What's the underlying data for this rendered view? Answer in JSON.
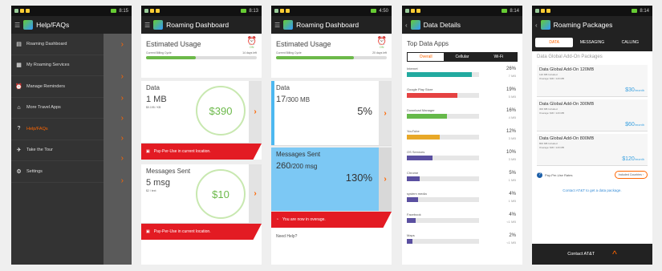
{
  "status": {
    "time1": "8:15",
    "time2": "8:13",
    "time3": "4:50",
    "time4": "8:14",
    "time5": "8:14"
  },
  "phone1": {
    "title": "Help/FAQs",
    "menu": [
      {
        "label": "Roaming Dashboard",
        "icon": "dashboard-icon"
      },
      {
        "label": "My Roaming Services",
        "icon": "services-icon"
      },
      {
        "label": "Manage Reminders",
        "icon": "reminder-icon"
      },
      {
        "label": "More Travel Apps",
        "icon": "travel-apps-icon"
      },
      {
        "label": "Help/FAQs",
        "icon": "help-icon"
      },
      {
        "label": "Take the Tour",
        "icon": "plane-icon"
      },
      {
        "label": "Settings",
        "icon": "gear-icon"
      }
    ]
  },
  "phone2": {
    "title": "Roaming Dashboard",
    "usage_title": "Estimated Usage",
    "cycle_label": "Current Billing Cycle",
    "days_left": "14 days left",
    "on": "ON",
    "cycle_progress": 0.45,
    "data_label": "Data",
    "data_value": "1 MB",
    "data_rate": "$0.195 / KB",
    "data_price": "$390",
    "alert1": "Pay-Per-Use in current location.",
    "msg_label": "Messages Sent",
    "msg_value": "5 msg",
    "msg_rate": "$2 / text",
    "msg_price": "$10",
    "alert2": "Pay-Per-Use in current location."
  },
  "phone3": {
    "title": "Roaming Dashboard",
    "usage_title": "Estimated Usage",
    "cycle_label": "Current Billing Cycle",
    "days_left": "20 days left",
    "on": "ON",
    "cycle_progress": 0.7,
    "data_label": "Data",
    "data_value": "17",
    "data_total": "/300 MB",
    "data_pct": "5%",
    "data_fill": 0.05,
    "msg_label": "Messages Sent",
    "msg_value": "260",
    "msg_total": "/200 msg",
    "msg_pct": "130%",
    "msg_fill": 1.0,
    "alert": "You are now in overage.",
    "help": "Need Help?"
  },
  "phone4": {
    "title": "Data Details",
    "heading": "Top Data Apps",
    "tabs": [
      "Overall",
      "Cellular",
      "Wi-Fi"
    ],
    "apps": [
      {
        "name": "Internet",
        "pct": "26%",
        "size": "7 MB",
        "fill": 0.9,
        "color": "#22aaa0"
      },
      {
        "name": "Google Play Store",
        "pct": "19%",
        "size": "5 MB",
        "fill": 0.7,
        "color": "#e54242"
      },
      {
        "name": "Download Manager",
        "pct": "16%",
        "size": "4 MB",
        "fill": 0.55,
        "color": "#66b94a"
      },
      {
        "name": "YouTube",
        "pct": "12%",
        "size": "3 MB",
        "fill": 0.45,
        "color": "#e8a828"
      },
      {
        "name": "OS Services",
        "pct": "10%",
        "size": "3 MB",
        "fill": 0.35,
        "color": "#5a4fa0"
      },
      {
        "name": "Chrome",
        "pct": "5%",
        "size": "1 MB",
        "fill": 0.18,
        "color": "#5a4fa0"
      },
      {
        "name": "system media",
        "pct": "4%",
        "size": "1 MB",
        "fill": 0.15,
        "color": "#5a4fa0"
      },
      {
        "name": "Facebook",
        "pct": "4%",
        "size": "<1 MB",
        "fill": 0.12,
        "color": "#5a4fa0"
      },
      {
        "name": "Maps",
        "pct": "2%",
        "size": "<1 MB",
        "fill": 0.08,
        "color": "#5a4fa0"
      }
    ]
  },
  "phone5": {
    "title": "Roaming Packages",
    "tabs": [
      "DATA",
      "MESSAGING",
      "CALLING"
    ],
    "section": "Data Global Add-On Packages",
    "packages": [
      {
        "name": "Data Global Add-On 120MB",
        "incl": "120 MB Included",
        "over": "Overage: $30 / 120 MB",
        "price": "$30",
        "unit": "/month"
      },
      {
        "name": "Data Global Add-On 300MB",
        "incl": "300 MB Included",
        "over": "Overage: $30 / 120 MB",
        "price": "$60",
        "unit": "/month"
      },
      {
        "name": "Data Global Add-On 800MB",
        "incl": "800 MB Included",
        "over": "Overage: $30 / 120 MB",
        "price": "$120",
        "unit": "/month"
      }
    ],
    "ppu": "Pay-Per-Use Rates",
    "countries": "Included Countries",
    "contact_link": "Contact AT&T to get a data package.",
    "footer": "Contact AT&T"
  }
}
